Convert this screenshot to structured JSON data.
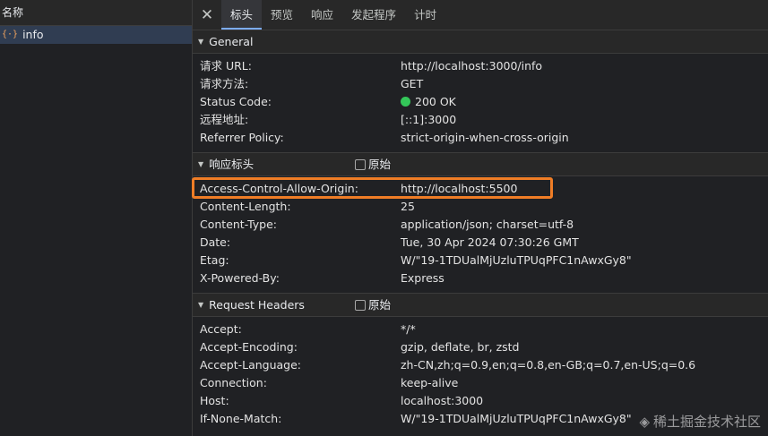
{
  "left": {
    "header": "名称",
    "items": [
      {
        "label": "info",
        "icon": "xhr-icon"
      }
    ]
  },
  "tabs": [
    {
      "label": "标头",
      "active": true
    },
    {
      "label": "预览"
    },
    {
      "label": "响应"
    },
    {
      "label": "发起程序"
    },
    {
      "label": "计时"
    }
  ],
  "general": {
    "title": "General",
    "rows": [
      {
        "key": "请求 URL:",
        "value": "http://localhost:3000/info"
      },
      {
        "key": "请求方法:",
        "value": "GET"
      },
      {
        "key": "Status Code:",
        "value": "200 OK"
      },
      {
        "key": "远程地址:",
        "value": "[::1]:3000"
      },
      {
        "key": "Referrer Policy:",
        "value": "strict-origin-when-cross-origin"
      }
    ]
  },
  "response_headers": {
    "title": "响应标头",
    "raw_label": "原始",
    "rows": [
      {
        "key": "Access-Control-Allow-Origin:",
        "value": "http://localhost:5500"
      },
      {
        "key": "Content-Length:",
        "value": "25"
      },
      {
        "key": "Content-Type:",
        "value": "application/json; charset=utf-8"
      },
      {
        "key": "Date:",
        "value": "Tue, 30 Apr 2024 07:30:26 GMT"
      },
      {
        "key": "Etag:",
        "value": "W/\"19-1TDUalMjUzluTPUqPFC1nAwxGy8\""
      },
      {
        "key": "X-Powered-By:",
        "value": "Express"
      }
    ]
  },
  "request_headers": {
    "title": "Request Headers",
    "raw_label": "原始",
    "rows": [
      {
        "key": "Accept:",
        "value": "*/*"
      },
      {
        "key": "Accept-Encoding:",
        "value": "gzip, deflate, br, zstd"
      },
      {
        "key": "Accept-Language:",
        "value": "zh-CN,zh;q=0.9,en;q=0.8,en-GB;q=0.7,en-US;q=0.6"
      },
      {
        "key": "Connection:",
        "value": "keep-alive"
      },
      {
        "key": "Host:",
        "value": "localhost:3000"
      },
      {
        "key": "If-None-Match:",
        "value": "W/\"19-1TDUalMjUzluTPUqPFC1nAwxGy8\""
      }
    ]
  },
  "watermark": "稀土掘金技术社区",
  "colors": {
    "highlight": "#ef7d26",
    "status_ok": "#34c759",
    "active_tab": "#7cacf8"
  }
}
